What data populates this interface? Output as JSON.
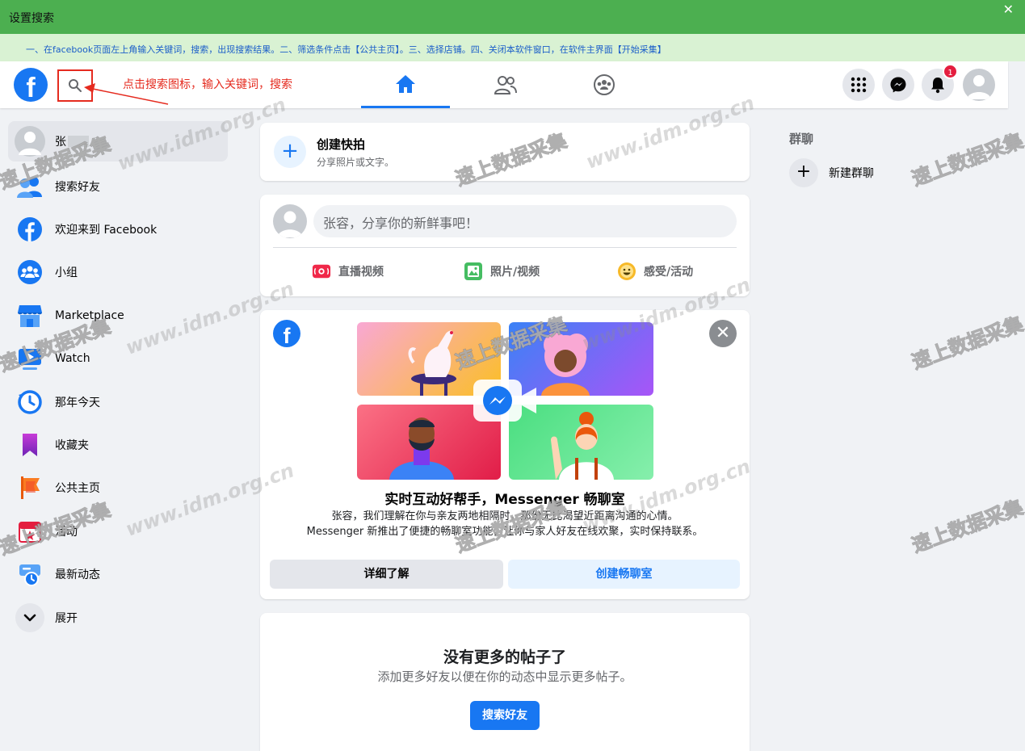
{
  "window": {
    "title": "设置搜索",
    "close_glyph": "✕"
  },
  "instruction": "一、在facebook页面左上角输入关键词，搜索，出现搜索结果。二、筛选条件点击【公共主页】。三、选择店铺。四、关闭本软件窗口，在软件主界面【开始采集】",
  "annotation": {
    "text": "点击搜索图标，输入关键词，搜索",
    "color": "#e52b1f"
  },
  "topnav": {
    "logo_letter": "f",
    "notification_count": "1",
    "accent": "#1877f2"
  },
  "sidebar": {
    "profile_name": "张",
    "items": [
      {
        "label": "搜索好友",
        "icon": "friends-icon"
      },
      {
        "label": "欢迎来到 Facebook",
        "icon": "facebook-icon"
      },
      {
        "label": "小组",
        "icon": "groups-icon"
      },
      {
        "label": "Marketplace",
        "icon": "marketplace-icon"
      },
      {
        "label": "Watch",
        "icon": "watch-icon"
      },
      {
        "label": "那年今天",
        "icon": "memories-icon"
      },
      {
        "label": "收藏夹",
        "icon": "saved-icon"
      },
      {
        "label": "公共主页",
        "icon": "pages-icon"
      },
      {
        "label": "活动",
        "icon": "events-icon"
      },
      {
        "label": "最新动态",
        "icon": "most-recent-icon"
      },
      {
        "label": "展开",
        "icon": "chevron-down-icon"
      }
    ]
  },
  "create_story": {
    "title": "创建快拍",
    "subtitle": "分享照片或文字。"
  },
  "composer": {
    "placeholder": "张容，分享你的新鲜事吧！",
    "actions": [
      {
        "label": "直播视频",
        "icon": "live-video-icon",
        "color": "#f02849"
      },
      {
        "label": "照片/视频",
        "icon": "photo-icon",
        "color": "#45bd62"
      },
      {
        "label": "感受/活动",
        "icon": "feeling-icon",
        "color": "#f7b928"
      }
    ]
  },
  "promo": {
    "logo_letter": "f",
    "close_glyph": "✕",
    "headline": "实时互动好帮手，Messenger 畅聊室",
    "body_line1": "张容，我们理解在你与亲友两地相隔时，那份无比渴望近距离沟通的心情。",
    "body_line2": "Messenger 新推出了便捷的畅聊室功能，让你与家人好友在线欢聚，实时保持联系。",
    "learn_more": "详细了解",
    "create_room": "创建畅聊室"
  },
  "no_more_posts": {
    "title": "没有更多的帖子了",
    "subtitle": "添加更多好友以便在你的动态中显示更多帖子。",
    "button": "搜索好友"
  },
  "right_column": {
    "title": "群聊",
    "new_group": "新建群聊"
  },
  "watermarks": {
    "url": "www.idm.org.cn",
    "cn": "速上数据采集"
  }
}
